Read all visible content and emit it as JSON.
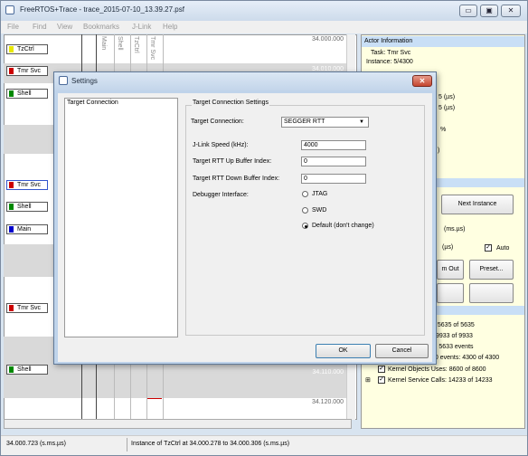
{
  "window": {
    "title": "FreeRTOS+Trace - trace_2015-07-10_13.39.27.psf",
    "minimize": "▭",
    "maximize": "▣",
    "close": "✕"
  },
  "menu": [
    "File",
    "Find",
    "View",
    "Bookmarks",
    "J-Link",
    "Help"
  ],
  "trace": {
    "lanes": [
      {
        "label": "TzCtrl",
        "color": "#e8e800"
      },
      {
        "label": "Tmr Svc",
        "color": "#cc0000"
      },
      {
        "label": "Shell",
        "color": "#008800"
      },
      {
        "label": "Tmr Svc",
        "color": "#cc0000"
      },
      {
        "label": "Shell",
        "color": "#008800"
      },
      {
        "label": "Main",
        "color": "#0000cc"
      },
      {
        "label": "Tmr Svc",
        "color": "#cc0000"
      },
      {
        "label": "Shell",
        "color": "#008800"
      }
    ],
    "columns": [
      "Main",
      "Shell",
      "TzCtrl",
      "Tmr Svc"
    ],
    "times": [
      "34.000.000",
      "34.010.000",
      "34.110.000",
      "34.120.000"
    ]
  },
  "actor_info": {
    "header": "Actor Information",
    "tree_task": "Task: Tmr Svc",
    "tree_instance": "Instance: 5/4300",
    "partial_lines": [
      "5 (µs)",
      "5 (µs)",
      "%",
      ")"
    ],
    "buttons": {
      "next_instance": "Next Instance",
      "zoom_out": "m Out",
      "preset": "Preset..."
    },
    "units_ms": "(ms.µs)",
    "units_us": "(µs)",
    "auto_label": "Auto",
    "stats": [
      ": 5635 of 5635",
      "9933 of 9933",
      "y: 5633 events",
      "00 events: 4300 of 4300",
      "Kernel Objects Uses: 8600 of 8600",
      "Kernel Service Calls: 14233 of 14233"
    ]
  },
  "status": {
    "time": "34.000.723 (s.ms.µs)",
    "instance": "Instance of TzCtrl at 34.000.278 to 34.000.306 (s.ms.µs)"
  },
  "dialog": {
    "title": "Settings",
    "close": "✕",
    "nav_items": [
      "Target Connection"
    ],
    "group_title": "Target Connection Settings",
    "target_connection_label": "Target Connection:",
    "target_connection_value": "SEGGER RTT",
    "jlink_speed_label": "J-Link Speed (kHz):",
    "jlink_speed_value": "4000",
    "up_buffer_label": "Target RTT Up Buffer Index:",
    "up_buffer_value": "0",
    "down_buffer_label": "Target RTT Down Buffer Index:",
    "down_buffer_value": "0",
    "debugger_label": "Debugger Interface:",
    "debugger_options": [
      "JTAG",
      "SWD",
      "Default (don't change)"
    ],
    "debugger_selected": 2,
    "ok": "OK",
    "cancel": "Cancel"
  }
}
